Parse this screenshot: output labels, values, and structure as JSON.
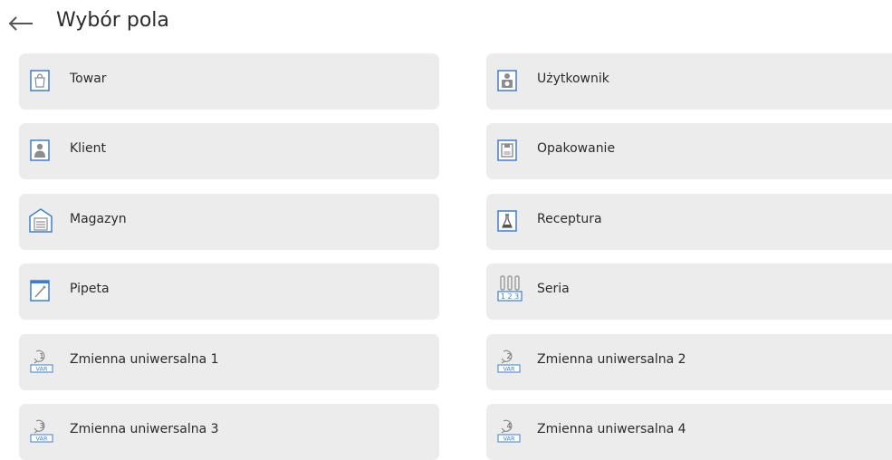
{
  "header": {
    "title": "Wybór pola"
  },
  "fields": [
    {
      "label": "Towar",
      "icon": "product-bag-icon"
    },
    {
      "label": "Użytkownik",
      "icon": "user-badge-icon"
    },
    {
      "label": "Klient",
      "icon": "client-person-icon"
    },
    {
      "label": "Opakowanie",
      "icon": "packaging-icon"
    },
    {
      "label": "Magazyn",
      "icon": "warehouse-icon"
    },
    {
      "label": "Receptura",
      "icon": "recipe-flask-icon"
    },
    {
      "label": "Pipeta",
      "icon": "pipette-icon"
    },
    {
      "label": "Seria",
      "icon": "series-icon"
    },
    {
      "label": "Zmienna uniwersalna 1",
      "icon": "universal-variable-1-icon",
      "var_number": "1"
    },
    {
      "label": "Zmienna uniwersalna 2",
      "icon": "universal-variable-2-icon",
      "var_number": "2"
    },
    {
      "label": "Zmienna uniwersalna 3",
      "icon": "universal-variable-3-icon",
      "var_number": "3"
    },
    {
      "label": "Zmienna uniwersalna 4",
      "icon": "universal-variable-4-icon",
      "var_number": "4"
    }
  ],
  "var_badge": "VAR",
  "series_digits": "1 2 3",
  "colors": {
    "icon_blue": "#3a7fd5",
    "icon_gray": "#8c8c8c",
    "tile_bg": "#ececec"
  }
}
